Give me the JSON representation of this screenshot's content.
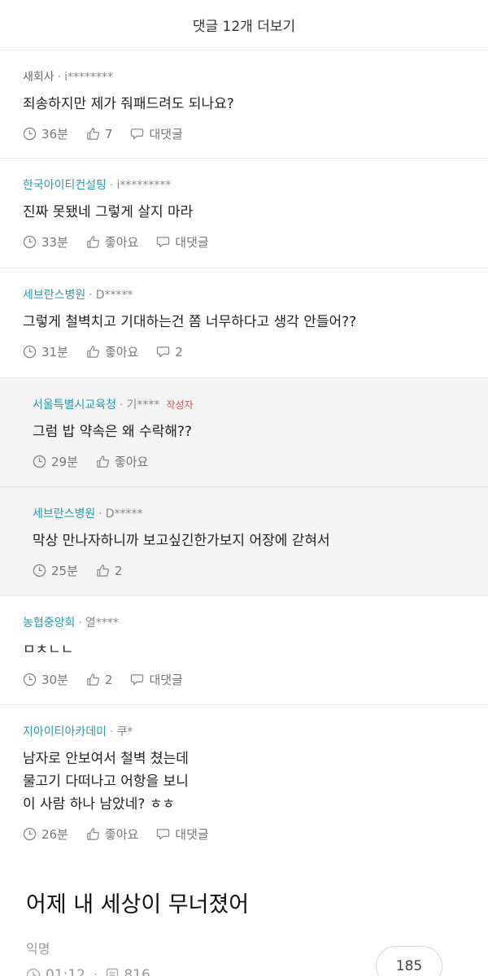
{
  "more_comments": "댓글 12개 더보기",
  "comments": [
    {
      "company": "새회사",
      "user": "i********",
      "text": "죄송하지만 제가 줘패드려도 되나요?",
      "time": "36분",
      "likes": "7",
      "reply": "대댓글"
    },
    {
      "company": "한국아이티컨설팅",
      "user": "i*********",
      "text": "진짜 못됐네 그렇게 살지 마라",
      "time": "33분",
      "likes": "좋아요",
      "reply": "대댓글"
    },
    {
      "company": "세브란스병원",
      "user": "D*****",
      "text": "그렇게 철벽치고 기대하는건 쫌 너무하다고 생각 안들어??",
      "time": "31분",
      "likes": "좋아요",
      "reply": "2"
    },
    {
      "company": "서울특별시교육청",
      "user": "기****",
      "badge": "작성자",
      "text": "그럼 밥 약속은 왜 수락해??",
      "time": "29분",
      "likes": "좋아요"
    },
    {
      "company": "세브란스병원",
      "user": "D*****",
      "text": "막상 만나자하니까 보고싶긴한가보지 어장에 갇혀서",
      "time": "25분",
      "likes": "2"
    },
    {
      "company": "농협중앙회",
      "user": "열****",
      "text": "ㅁㅊㄴㄴ",
      "time": "30분",
      "likes": "2",
      "reply": "대댓글"
    },
    {
      "company": "지아이티아카데미",
      "user": "쿠*",
      "text": "남자로 안보여서 철벽 쳤는데\n물고기 다떠나고 어항을 보니\n이 사람 하나 남았네? ㅎㅎ",
      "time": "26분",
      "likes": "좋아요",
      "reply": "대댓글"
    }
  ],
  "post": {
    "title": "어제 내 세상이 무너졌어",
    "author": "익명",
    "time": "01:12",
    "views": "816",
    "comment_count": "185"
  },
  "icons": {
    "clock": "clock-icon",
    "like": "thumbs-up-icon",
    "reply": "speech-bubble-icon",
    "views": "document-icon"
  },
  "colors": {
    "company": "#2a9bb0",
    "author_badge": "#e05050",
    "reply_background": "#f4f4f4"
  }
}
